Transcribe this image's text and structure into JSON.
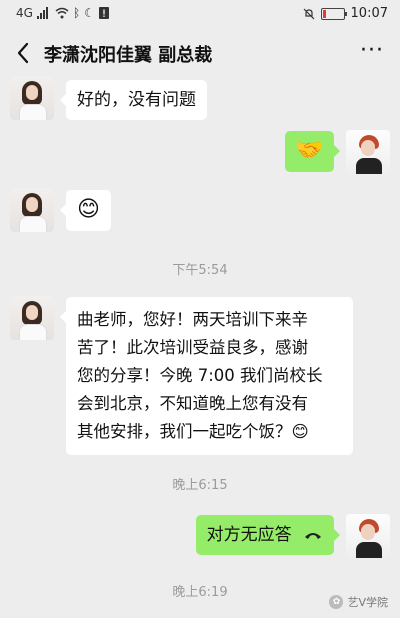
{
  "status_bar": {
    "network": "4G",
    "time": "10:07",
    "battery_level": 0.18,
    "battery_color": "#e53935"
  },
  "header": {
    "title": "李潇沈阳佳翼 副总裁",
    "back_icon": "chevron-left-icon",
    "more_icon": "more-dots-icon",
    "more_label": "···"
  },
  "messages": {
    "m1": {
      "text": "好的，没有问题"
    },
    "m2": {
      "emoji": "🤝"
    },
    "m3": {
      "emoji": "😊"
    },
    "ts1": {
      "text": "下午5:54"
    },
    "m4": {
      "line1": "曲老师，您好！两天培训下来辛",
      "line2": "苦了！此次培训受益良多，感谢",
      "line3": "您的分享！今晚 7:00 我们尚校长",
      "line4": "会到北京，不知道晚上您有没有",
      "line5": "其他安排，我们一起吃个饭？😊"
    },
    "ts2": {
      "text": "晚上6:15"
    },
    "m5": {
      "text": "对方无应答"
    },
    "ts3": {
      "text": "晚上6:19"
    }
  },
  "watermark": {
    "text": "艺V学院"
  },
  "colors": {
    "background": "#ededed",
    "incoming_bubble": "#ffffff",
    "outgoing_bubble": "#95ec69"
  }
}
